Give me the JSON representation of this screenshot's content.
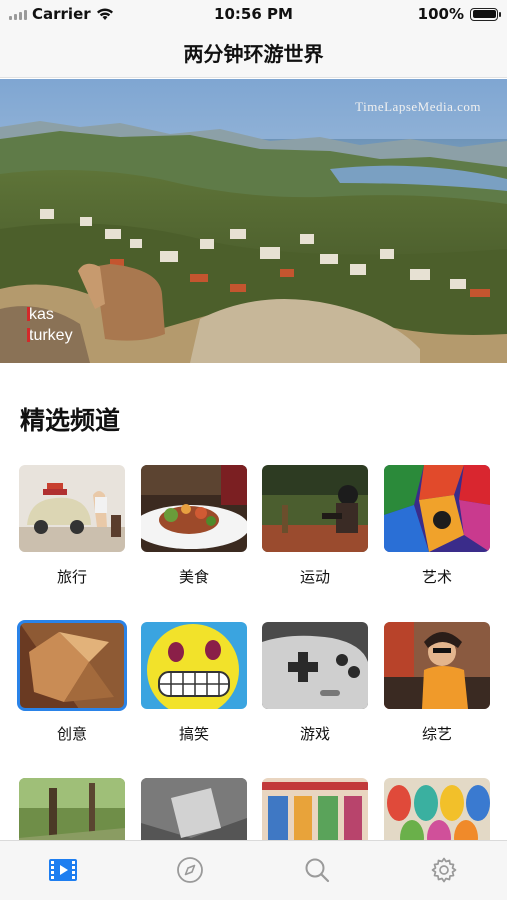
{
  "status_bar": {
    "carrier": "Carrier",
    "time": "10:56 PM",
    "battery": "100%",
    "battery_level": 1.0
  },
  "nav": {
    "title": "两分钟环游世界"
  },
  "hero": {
    "watermark": "TimeLapseMedia.com",
    "location_line1": "kas",
    "location_line2": "turkey"
  },
  "section": {
    "title": "精选频道"
  },
  "channels": [
    {
      "label": "旅行"
    },
    {
      "label": "美食"
    },
    {
      "label": "运动"
    },
    {
      "label": "艺术"
    },
    {
      "label": "创意",
      "selected": true
    },
    {
      "label": "搞笑"
    },
    {
      "label": "游戏"
    },
    {
      "label": "综艺"
    },
    {
      "label": ""
    },
    {
      "label": ""
    },
    {
      "label": ""
    },
    {
      "label": ""
    }
  ],
  "tabbar": {
    "items": [
      {
        "icon": "film-icon",
        "active": true
      },
      {
        "icon": "compass-icon",
        "active": false
      },
      {
        "icon": "search-icon",
        "active": false
      },
      {
        "icon": "gear-icon",
        "active": false
      }
    ],
    "active_color": "#1e7ef0",
    "inactive_color": "#9a9a9a"
  }
}
